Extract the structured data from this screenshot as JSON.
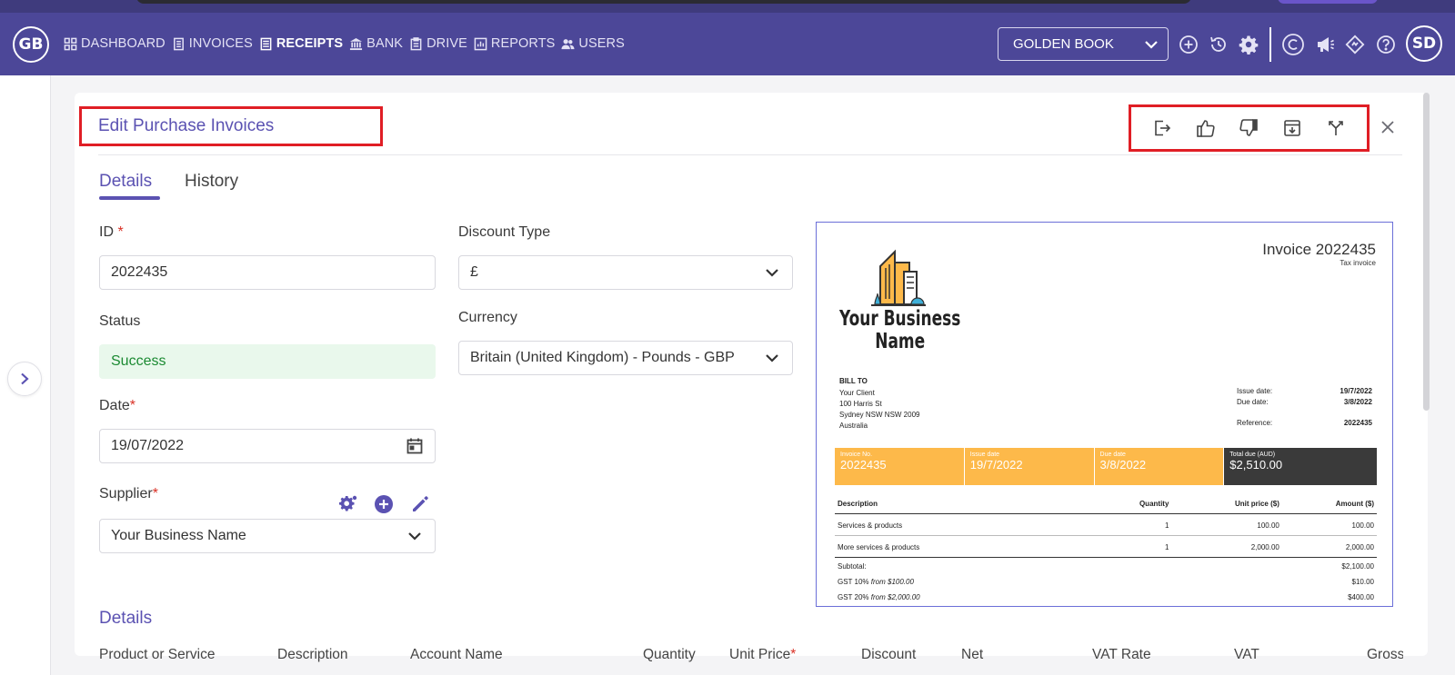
{
  "header": {
    "user_initials": "GB",
    "profile_initials": "SD",
    "company_selector": "GOLDEN BOOK",
    "nav": [
      {
        "label": "DASHBOARD",
        "icon": "grid-icon"
      },
      {
        "label": "INVOICES",
        "icon": "document-icon"
      },
      {
        "label": "RECEIPTS",
        "icon": "receipt-icon",
        "active": true
      },
      {
        "label": "BANK",
        "icon": "bank-icon"
      },
      {
        "label": "DRIVE",
        "icon": "clipboard-icon"
      },
      {
        "label": "REPORTS",
        "icon": "bar-chart-icon"
      },
      {
        "label": "USERS",
        "icon": "users-icon"
      }
    ],
    "toolbar_icons": [
      "add-circle-icon",
      "history-icon",
      "gear-icon",
      "c-logo-icon",
      "megaphone-icon",
      "diamond-icon",
      "help-icon"
    ]
  },
  "page": {
    "title": "Edit Purchase Invoices",
    "actions": [
      "export-icon",
      "thumbs-up-icon",
      "thumbs-down-icon",
      "archive-icon",
      "split-icon"
    ],
    "tabs": [
      {
        "label": "Details",
        "active": true
      },
      {
        "label": "History",
        "active": false
      }
    ]
  },
  "form": {
    "id_label": "ID",
    "id_required": "*",
    "id_value": "2022435",
    "status_label": "Status",
    "status_value": "Success",
    "date_label": "Date",
    "date_required": "*",
    "date_value": "19/07/2022",
    "supplier_label": "Supplier",
    "supplier_required": "*",
    "supplier_value": "Your Business Name",
    "discount_type_label": "Discount Type",
    "discount_type_value": "£",
    "currency_label": "Currency",
    "currency_value": "Britain (United Kingdom) - Pounds - GBP"
  },
  "details": {
    "section_title": "Details",
    "columns": [
      "Product or Service",
      "Description",
      "Account Name",
      "Quantity",
      "Unit Price",
      "Discount",
      "Net",
      "VAT Rate",
      "VAT",
      "Gross"
    ],
    "unit_price_required": "*"
  },
  "invoice": {
    "title": "Invoice 2022435",
    "subtitle": "Tax invoice",
    "business_name_line1": "Your Business",
    "business_name_line2": "Name",
    "bill_to_label": "BILL TO",
    "bill_to": [
      "Your Client",
      "100 Harris St",
      "Sydney NSW NSW 2009",
      "Australia"
    ],
    "meta": [
      {
        "label": "Issue date:",
        "value": "19/7/2022"
      },
      {
        "label": "Due date:",
        "value": "3/8/2022"
      },
      {
        "label": "Reference:",
        "value": "2022435"
      }
    ],
    "summary": [
      {
        "label": "Invoice No.",
        "value": "2022435"
      },
      {
        "label": "Issue date",
        "value": "19/7/2022"
      },
      {
        "label": "Due date",
        "value": "3/8/2022"
      },
      {
        "label": "Total due (AUD)",
        "value": "$2,510.00"
      }
    ],
    "table_headers": [
      "Description",
      "Quantity",
      "Unit price ($)",
      "Amount ($)"
    ],
    "rows": [
      {
        "description": "Services & products",
        "quantity": "1",
        "unit_price": "100.00",
        "amount": "100.00"
      },
      {
        "description": "More services & products",
        "quantity": "1",
        "unit_price": "2,000.00",
        "amount": "2,000.00"
      }
    ],
    "subtotal_label": "Subtotal:",
    "subtotal_value": "$2,100.00",
    "gst1_label": "GST 10%",
    "gst1_from": "from $100.00",
    "gst1_value": "$10.00",
    "gst2_label": "GST 20%",
    "gst2_from": "from $2,000.00",
    "gst2_value": "$400.00",
    "colors": {
      "accent": "#fdb94a",
      "dark": "#3a3a3a"
    }
  }
}
